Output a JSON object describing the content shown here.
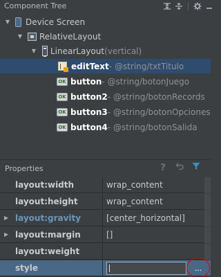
{
  "component_tree": {
    "title": "Component Tree",
    "tools": [
      "expand-all-icon",
      "collapse-all-icon",
      "gear-icon",
      "hide-panel-icon"
    ],
    "nodes": [
      {
        "name": "Device Screen",
        "suffix": "",
        "icon": "device-screen-icon",
        "expanded": true,
        "bold": false
      },
      {
        "name": "RelativeLayout",
        "suffix": "",
        "icon": "relative-layout-icon",
        "expanded": true,
        "bold": false
      },
      {
        "name": "LinearLayout",
        "suffix": " (vertical)",
        "icon": "linear-layout-icon",
        "expanded": true,
        "bold": false
      },
      {
        "name": "editText",
        "suffix": " - @string/txtTitulo",
        "icon": "edit-text-icon",
        "expanded": false,
        "bold": true,
        "selected": true
      },
      {
        "name": "button",
        "suffix": " - @string/botonJuego",
        "icon": "button-ok-icon",
        "expanded": false,
        "bold": true
      },
      {
        "name": "button2",
        "suffix": " - @string/botonRecords",
        "icon": "button-ok-icon",
        "expanded": false,
        "bold": true
      },
      {
        "name": "button3",
        "suffix": " - @string/botonOpciones",
        "icon": "button-ok-icon",
        "expanded": false,
        "bold": true
      },
      {
        "name": "button4",
        "suffix": " - @string/botonSalida",
        "icon": "button-ok-icon",
        "expanded": false,
        "bold": true
      }
    ],
    "ok_badge": "OK"
  },
  "properties": {
    "title": "Properties",
    "tools": [
      "help-icon",
      "restore-icon",
      "filter-icon"
    ],
    "help_label": "?",
    "rows": [
      {
        "name": "layout:width",
        "value": "wrap_content",
        "expandable": false,
        "linked": false
      },
      {
        "name": "layout:height",
        "value": "wrap_content",
        "expandable": false,
        "linked": false
      },
      {
        "name": "layout:gravity",
        "value": "[center_horizontal]",
        "expandable": true,
        "linked": true
      },
      {
        "name": "layout:margin",
        "value": "[]",
        "expandable": true,
        "linked": false
      },
      {
        "name": "layout:weight",
        "value": "",
        "expandable": false,
        "linked": false
      },
      {
        "name": "style",
        "value": "",
        "expandable": false,
        "linked": false,
        "selected": true,
        "editing": true
      }
    ],
    "more_button_label": "...",
    "highlight_color": "#e00000"
  },
  "colors": {
    "panel_bg": "#3c3f41",
    "selection_bg": "#2f4b6d",
    "selected_row_bg": "#4a6886",
    "link_text": "#6897bb"
  }
}
